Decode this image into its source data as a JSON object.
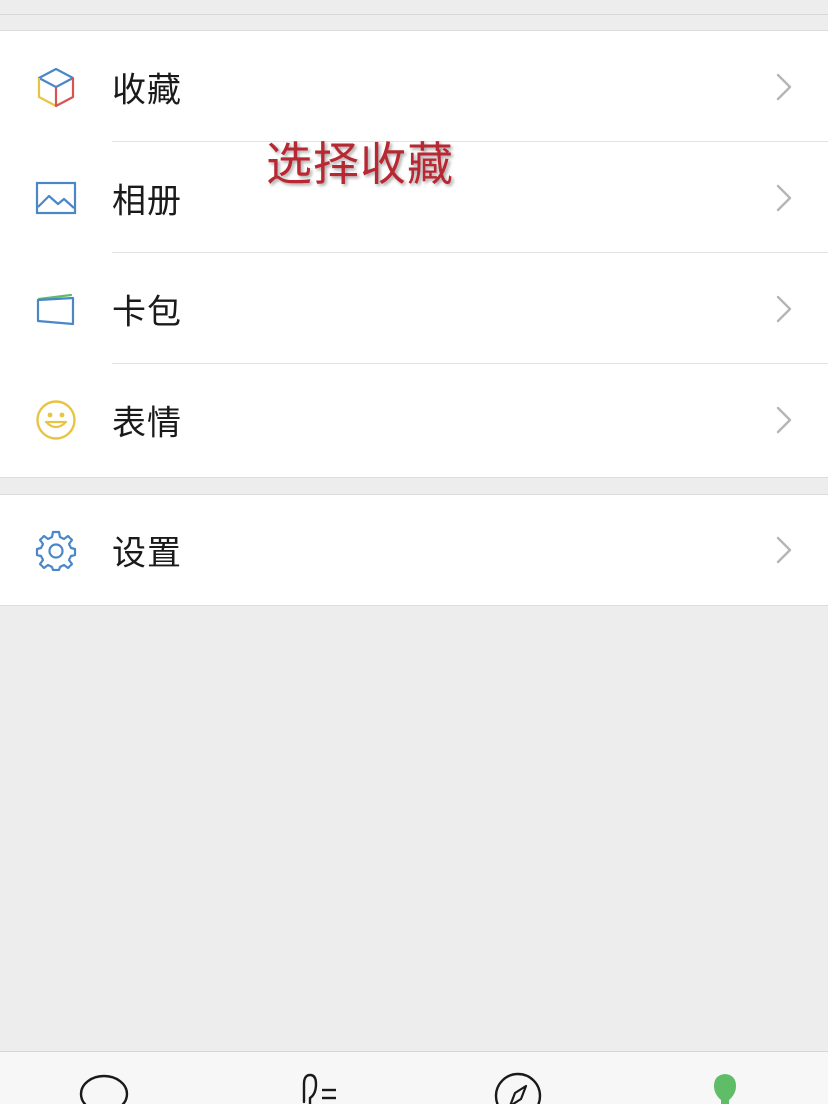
{
  "menu_group_1": {
    "items": [
      {
        "label": "收藏",
        "icon": "favorites-cube-icon"
      },
      {
        "label": "相册",
        "icon": "album-image-icon"
      },
      {
        "label": "卡包",
        "icon": "card-wallet-icon"
      },
      {
        "label": "表情",
        "icon": "stickers-smiley-icon"
      }
    ]
  },
  "menu_group_2": {
    "items": [
      {
        "label": "设置",
        "icon": "settings-gear-icon"
      }
    ]
  },
  "annotation": {
    "text": "选择收藏"
  },
  "tabbar": {
    "tabs": [
      {
        "icon": "chats-icon"
      },
      {
        "icon": "contacts-icon"
      },
      {
        "icon": "discover-icon"
      },
      {
        "icon": "me-icon",
        "active": true
      }
    ],
    "active_color": "#5fbd68"
  },
  "colors": {
    "annotation": "#b82832",
    "icon_blue": "#4a87c9",
    "icon_yellow": "#e7c443"
  }
}
